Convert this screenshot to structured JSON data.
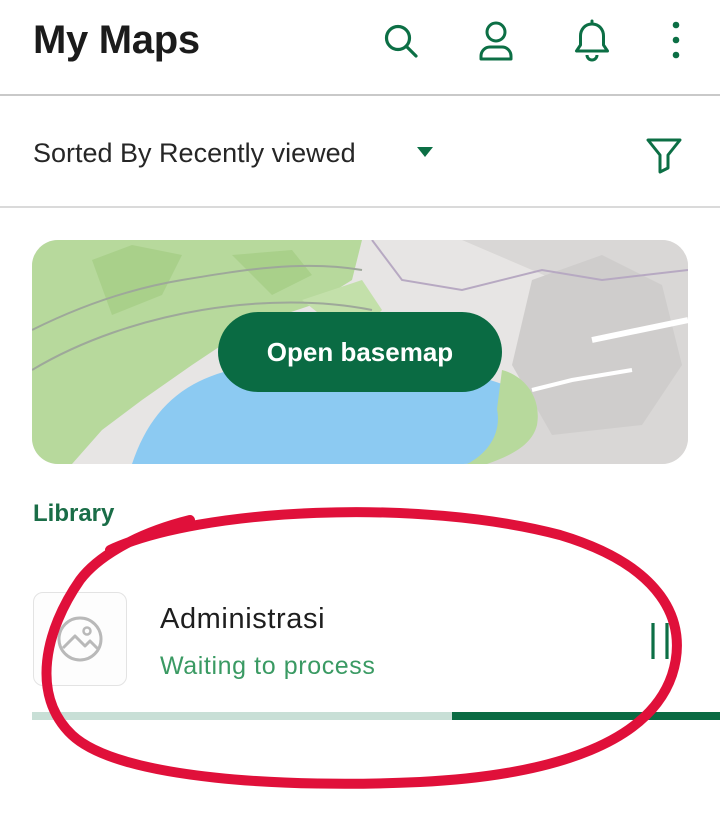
{
  "header": {
    "title": "My Maps",
    "icons": [
      "search-icon",
      "account-icon",
      "notifications-icon",
      "more-vertical-icon"
    ]
  },
  "sort": {
    "label": "Sorted By Recently viewed",
    "icon": "caret-down-icon",
    "filter_icon": "filter-icon"
  },
  "basemap": {
    "button_label": "Open basemap"
  },
  "library": {
    "label": "Library",
    "items": [
      {
        "name": "Administrasi",
        "status": "Waiting to process",
        "thumbnail_icon": "image-placeholder-icon",
        "action_icon": "pause-icon",
        "progress": 0.61
      }
    ]
  },
  "colors": {
    "brand_green": "#0a6b43",
    "status_green": "#3a9a63",
    "annotation_red": "#e0103a"
  }
}
